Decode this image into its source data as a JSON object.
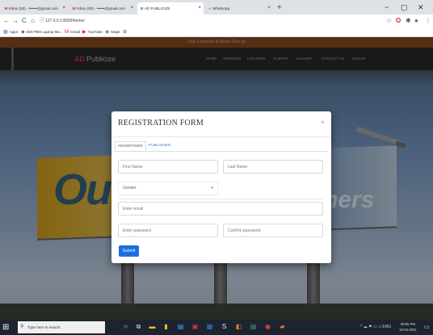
{
  "browser": {
    "tabs": [
      {
        "label": "Inbox (53) - l••••••@gmail.com",
        "icon": "gmail-icon",
        "glyph": "M"
      },
      {
        "label": "Inbox (30) - ••••••@gmail.com",
        "icon": "gmail-icon",
        "glyph": "M"
      },
      {
        "label": "AD PUBLICIZE",
        "icon": "ad-favicon-icon",
        "glyph": "⊘"
      },
      {
        "label": "WhatsApp",
        "icon": "whatsapp-icon",
        "glyph": "●"
      }
    ],
    "new_tab": "+",
    "window_controls": {
      "minimize": "−",
      "maximize": "▢",
      "close": "✕"
    },
    "nav": {
      "back": "←",
      "forward": "→",
      "reload": "C",
      "home": "⌂"
    },
    "url": "127.0.0.1:8000/home/",
    "bookmarks": [
      {
        "label": "Apps",
        "icon": "apps-grid-icon",
        "glyph": "▦"
      },
      {
        "label": "Dell PBS Laptop Mo...",
        "icon": "dell-icon",
        "glyph": "◆"
      },
      {
        "label": "Gmail",
        "icon": "gmail-icon",
        "glyph": "M"
      },
      {
        "label": "YouTube",
        "icon": "youtube-icon",
        "glyph": "▶"
      },
      {
        "label": "Maps",
        "icon": "maps-icon",
        "glyph": "◉"
      }
    ]
  },
  "site": {
    "top_strip": "Stay Focussed & Never Give up",
    "logo_mark": "AD",
    "logo_text": "Publicize",
    "nav_links": [
      "HOME",
      "SERVICES",
      "LOCATION",
      "CLIENTS",
      "GALLERY",
      "CONTACT US",
      "SIGN IN"
    ],
    "billboard_left": "Out",
    "billboard_right": "ners"
  },
  "modal": {
    "title": "REGISTRATION FORM",
    "close": "×",
    "tabs": [
      "ADVERTISER",
      "PUBLISHER"
    ],
    "first_name_placeholder": "First Name",
    "last_name_placeholder": "Last Name",
    "gender_value": "Gender",
    "email_placeholder": "Enter email",
    "password_placeholder": "Enter password",
    "confirm_password_placeholder": "Confirm password",
    "submit": "Submit"
  },
  "taskbar": {
    "search_placeholder": "Type here to search",
    "clock_time": "09:05 PM",
    "clock_date": "18-03-2021"
  },
  "colors": {
    "accent": "#1a6fe0",
    "publisher_tab": "#3b7ddd",
    "logo_mark": "#dd3333",
    "top_strip": "#8a4a20"
  }
}
